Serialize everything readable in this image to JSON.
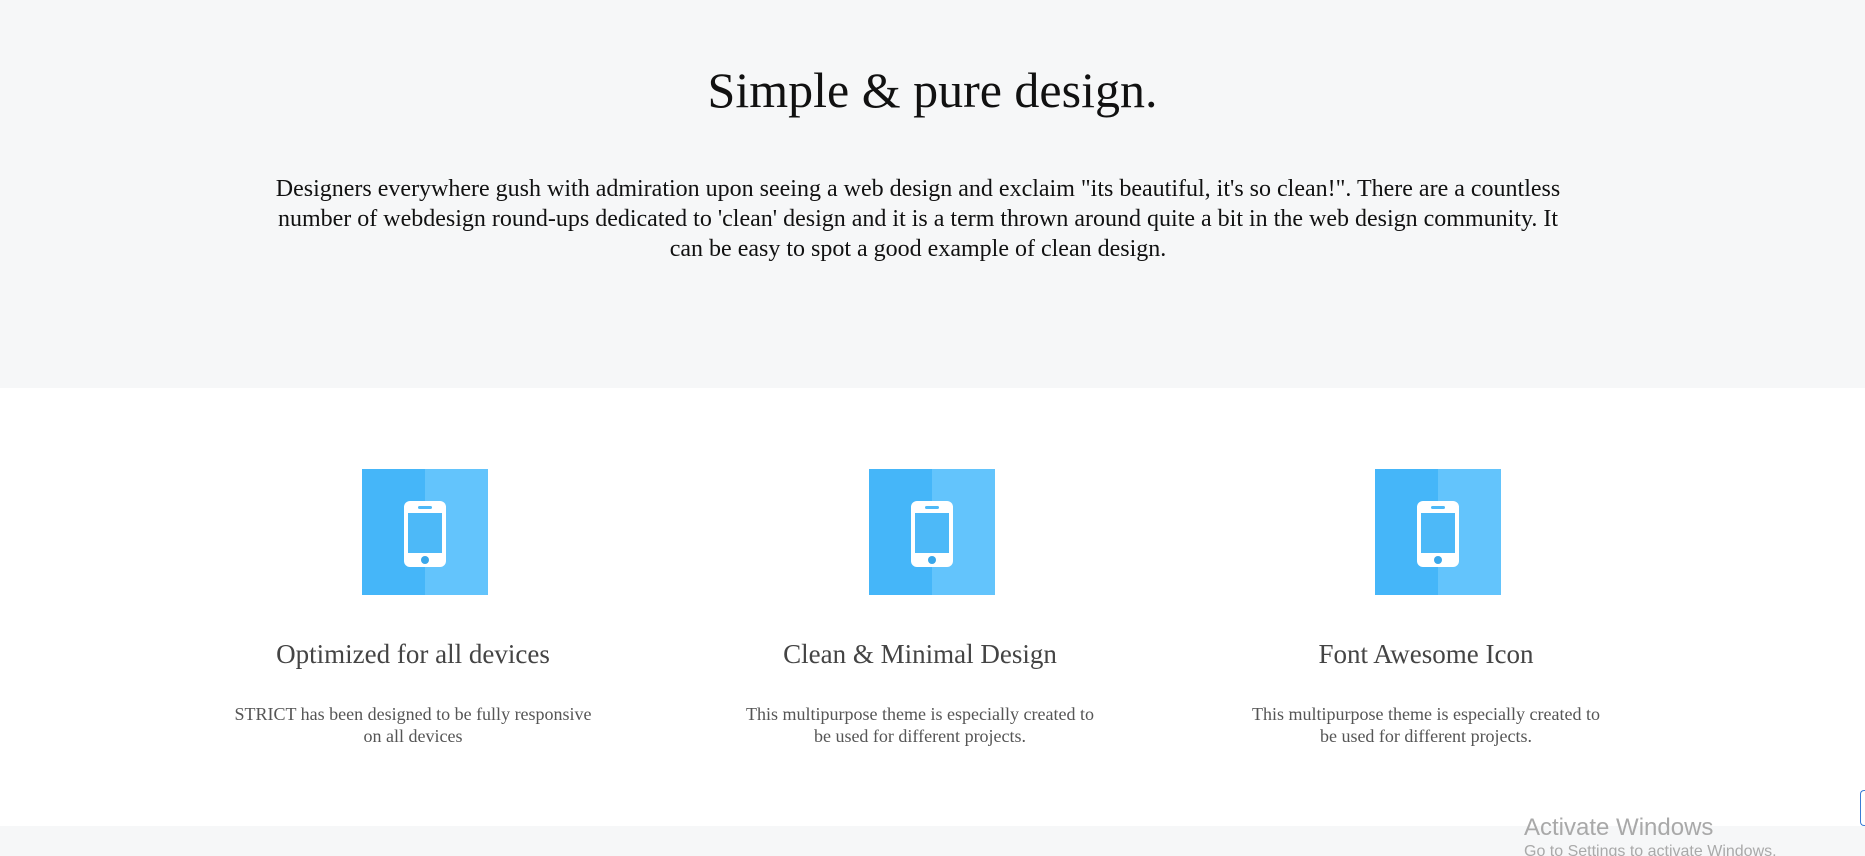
{
  "hero": {
    "title": "Simple & pure design.",
    "text": "Designers everywhere gush with admiration upon seeing a web design and exclaim \"its beautiful, it's so clean!\". There are a countless number of webdesign round-ups dedicated to 'clean' design and it is a term thrown around quite a bit in the web design community. It can be easy to spot a good example of clean design."
  },
  "features": [
    {
      "icon": "smartphone-icon",
      "title": "Optimized for all devices",
      "text": "STRICT has been designed to be fully responsive on all devices"
    },
    {
      "icon": "smartphone-icon",
      "title": "Clean & Minimal Design",
      "text": "This multipurpose theme is especially created to be used for different projects."
    },
    {
      "icon": "smartphone-icon",
      "title": "Font Awesome Icon",
      "text": "This multipurpose theme is especially created to be used for different projects."
    }
  ],
  "watermark": {
    "title": "Activate Windows",
    "subtitle": "Go to Settings to activate Windows."
  },
  "colors": {
    "hero_bg": "#f6f7f8",
    "icon_dark": "#45b6f9",
    "icon_light": "#63c4fc",
    "title_text": "#111111",
    "feature_title": "#444444"
  }
}
